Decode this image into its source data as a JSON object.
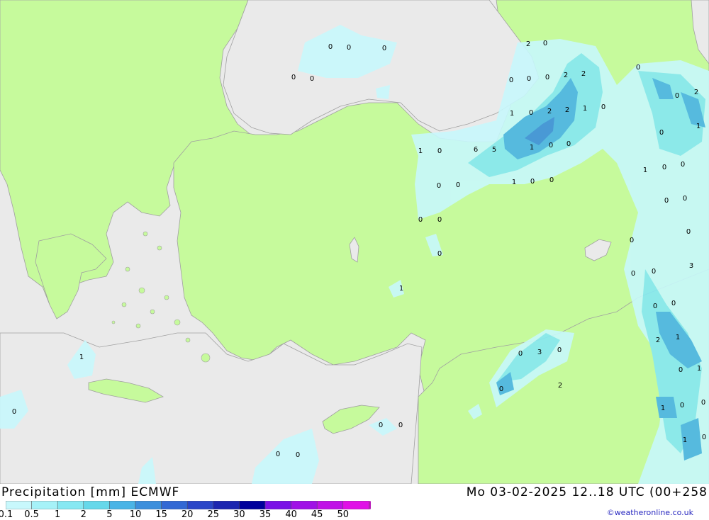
{
  "header": {
    "title": "Precipitation [mm] ECMWF",
    "valid_time": "Mo 03-02-2025 12..18 UTC (00+258"
  },
  "legend": {
    "labels": [
      "0.1",
      "0.5",
      "1",
      "2",
      "5",
      "10",
      "15",
      "20",
      "25",
      "30",
      "35",
      "40",
      "45",
      "50"
    ],
    "colors": [
      "#c8f8fc",
      "#a6f2f8",
      "#86e8f2",
      "#66d8ea",
      "#4ab4e6",
      "#3c8fdc",
      "#3268d4",
      "#2a46c8",
      "#1c26b0",
      "#00009c",
      "#7a10e6",
      "#a010e6",
      "#c010e6",
      "#e010e6",
      "#b81ab8"
    ]
  },
  "colors": {
    "land": "#c6fa9c",
    "sea": "#eaeaea",
    "border": "#a0a0a0",
    "precip_light": "#c8f8fc",
    "precip_mid": "#86e8f2",
    "precip_high": "#4ab4e6"
  },
  "credit": "©weatheronline.co.uk",
  "map_values": [
    "0",
    "0",
    "0",
    "0",
    "0",
    "2",
    "0",
    "0",
    "0",
    "0",
    "2",
    "2",
    "0",
    "1",
    "0",
    "2",
    "2",
    "1",
    "0",
    "0",
    "2",
    "0",
    "1",
    "1",
    "0",
    "6",
    "5",
    "1",
    "0",
    "0",
    "1",
    "0",
    "0",
    "0",
    "0",
    "1",
    "0",
    "0",
    "0",
    "0",
    "0",
    "0",
    "0",
    "0",
    "0",
    "0",
    "3",
    "0",
    "1",
    "0",
    "0",
    "2",
    "1",
    "1",
    "0",
    "3",
    "0",
    "0",
    "1",
    "0",
    "2",
    "1",
    "0",
    "0",
    "1",
    "0",
    "0",
    "0",
    "0",
    "0",
    "0"
  ]
}
